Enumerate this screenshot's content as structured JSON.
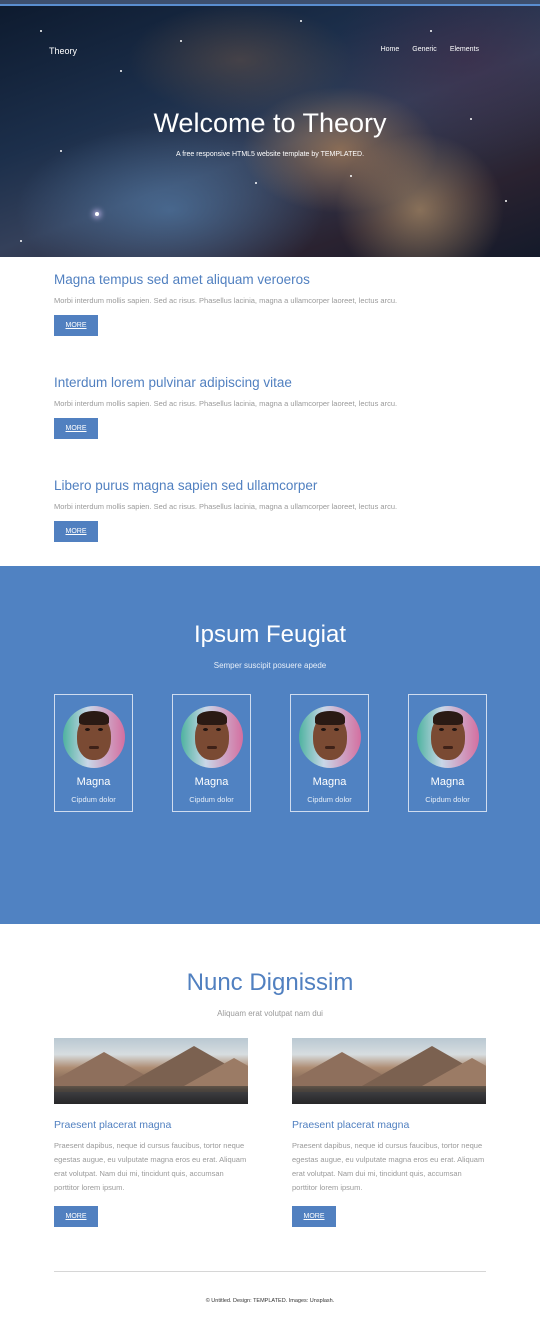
{
  "header": {
    "brand": "Theory",
    "nav": [
      "Home",
      "Generic",
      "Elements"
    ]
  },
  "hero": {
    "title": "Welcome to Theory",
    "subtitle": "A free responsive HTML5 website template by TEMPLATED."
  },
  "articles": [
    {
      "title": "Magna tempus sed amet aliquam veroeros",
      "text": "Morbi interdum mollis sapien. Sed ac risus. Phasellus lacinia, magna a ullamcorper laoreet, lectus arcu.",
      "button": "MORE"
    },
    {
      "title": "Interdum lorem pulvinar adipiscing vitae",
      "text": "Morbi interdum mollis sapien. Sed ac risus. Phasellus lacinia, magna a ullamcorper laoreet, lectus arcu.",
      "button": "MORE"
    },
    {
      "title": "Libero purus magna sapien sed ullamcorper",
      "text": "Morbi interdum mollis sapien. Sed ac risus. Phasellus lacinia, magna a ullamcorper laoreet, lectus arcu.",
      "button": "MORE"
    }
  ],
  "team": {
    "title": "Ipsum Feugiat",
    "subtitle": "Semper suscipit posuere apede",
    "members": [
      {
        "name": "Magna",
        "role": "Cipdum dolor"
      },
      {
        "name": "Magna",
        "role": "Cipdum dolor"
      },
      {
        "name": "Magna",
        "role": "Cipdum dolor"
      },
      {
        "name": "Magna",
        "role": "Cipdum dolor"
      }
    ]
  },
  "features": {
    "title": "Nunc Dignissim",
    "subtitle": "Aliquam erat volutpat nam dui",
    "items": [
      {
        "title": "Praesent placerat magna",
        "text": "Praesent dapibus, neque id cursus faucibus, tortor neque egestas augue, eu vulputate magna eros eu erat. Aliquam erat volutpat. Nam dui mi, tincidunt quis, accumsan porttitor lorem ipsum.",
        "button": "MORE"
      },
      {
        "title": "Praesent placerat magna",
        "text": "Praesent dapibus, neque id cursus faucibus, tortor neque egestas augue, eu vulputate magna eros eu erat. Aliquam erat volutpat. Nam dui mi, tincidunt quis, accumsan porttitor lorem ipsum.",
        "button": "MORE"
      }
    ]
  },
  "footer": {
    "copyright": "© Untitled. Design: TEMPLATED. Images: Unsplash."
  },
  "colors": {
    "accent": "#5180c0",
    "team_background": "#5082c2"
  }
}
